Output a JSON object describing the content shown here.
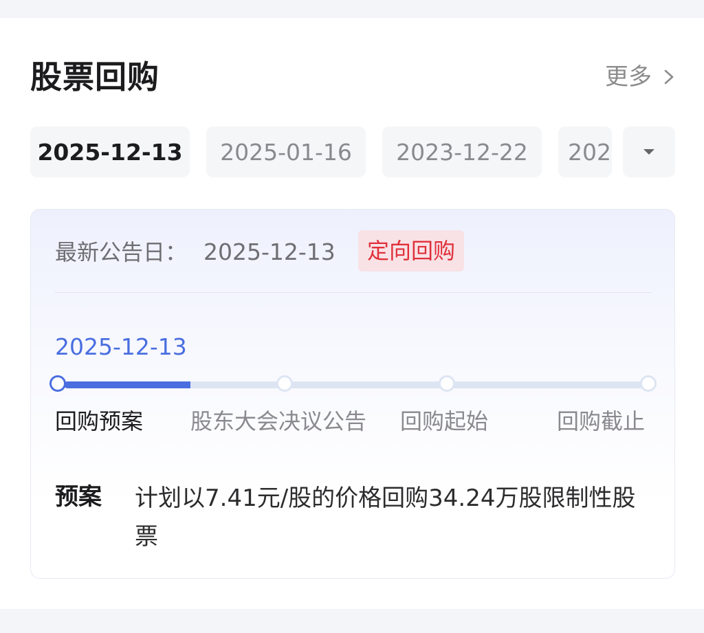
{
  "section": {
    "title": "股票回购",
    "more_label": "更多"
  },
  "date_tabs": [
    {
      "label": "2025-12-13",
      "active": true
    },
    {
      "label": "2025-01-16",
      "active": false
    },
    {
      "label": "2023-12-22",
      "active": false
    },
    {
      "label": "202",
      "active": false
    }
  ],
  "detail": {
    "latest_label": "最新公告日：",
    "latest_date": "2025-12-13",
    "badge": "定向回购",
    "progress_date": "2025-12-13",
    "steps": [
      {
        "label": "回购预案",
        "done": true
      },
      {
        "label": "股东大会决议公告",
        "done": false
      },
      {
        "label": "回购起始",
        "done": false
      },
      {
        "label": "回购截止",
        "done": false
      }
    ],
    "plan_label": "预案",
    "plan_text": "计划以7.41元/股的价格回购34.24万股限制性股票"
  },
  "colors": {
    "accent": "#4a6ee0",
    "badge_text": "#e0303a",
    "badge_bg": "#f8e2e6"
  }
}
